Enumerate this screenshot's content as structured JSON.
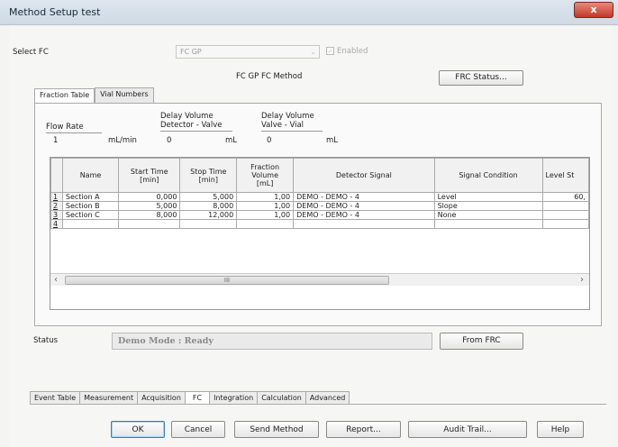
{
  "window": {
    "title": "Method Setup test",
    "close": "x"
  },
  "select_fc": {
    "label": "Select FC",
    "value": "FC GP",
    "enabled_label": "Enabled",
    "checkmark": "✓"
  },
  "method_label": "FC GP FC Method",
  "frc_status_button": "FRC Status...",
  "inner_tabs": [
    {
      "label": "Fraction Table"
    },
    {
      "label": "Vial Numbers"
    }
  ],
  "params": {
    "flow_rate": {
      "label": "Flow Rate",
      "value": "1",
      "unit": "mL/min"
    },
    "delay_detector": {
      "label1": "Delay Volume",
      "label2": "Detector - Valve",
      "value": "0",
      "unit": "mL"
    },
    "delay_valve": {
      "label1": "Delay Volume",
      "label2": "Valve - Vial",
      "value": "0",
      "unit": "mL"
    }
  },
  "table": {
    "headers": [
      "",
      "Name",
      "Start Time\n[min]",
      "Stop Time\n[min]",
      "Fraction\nVolume\n[mL]",
      "Detector Signal",
      "Signal Condition",
      "Level St"
    ],
    "rows": [
      [
        "1",
        "Section A",
        "0,000",
        "5,000",
        "1,00",
        "DEMO - DEMO - 4",
        "Level",
        "60,"
      ],
      [
        "2",
        "Section B",
        "5,000",
        "8,000",
        "1,00",
        "DEMO - DEMO - 4",
        "Slope",
        ""
      ],
      [
        "3",
        "Section C",
        "8,000",
        "12,000",
        "1,00",
        "DEMO - DEMO - 4",
        "None",
        ""
      ],
      [
        "4",
        "",
        "",
        "",
        "",
        "",
        "",
        ""
      ]
    ]
  },
  "scrollbar": {
    "left": "‹",
    "right": "›",
    "grip": "III"
  },
  "status": {
    "label": "Status",
    "value": "Demo Mode : Ready",
    "from_frc": "From FRC"
  },
  "bottom_tabs": [
    {
      "label": "Event Table"
    },
    {
      "label": "Measurement"
    },
    {
      "label": "Acquisition"
    },
    {
      "label": "FC"
    },
    {
      "label": "Integration"
    },
    {
      "label": "Calculation"
    },
    {
      "label": "Advanced"
    }
  ],
  "buttons": {
    "ok": "OK",
    "cancel": "Cancel",
    "send": "Send Method",
    "report": "Report...",
    "audit": "Audit Trail...",
    "help": "Help"
  }
}
